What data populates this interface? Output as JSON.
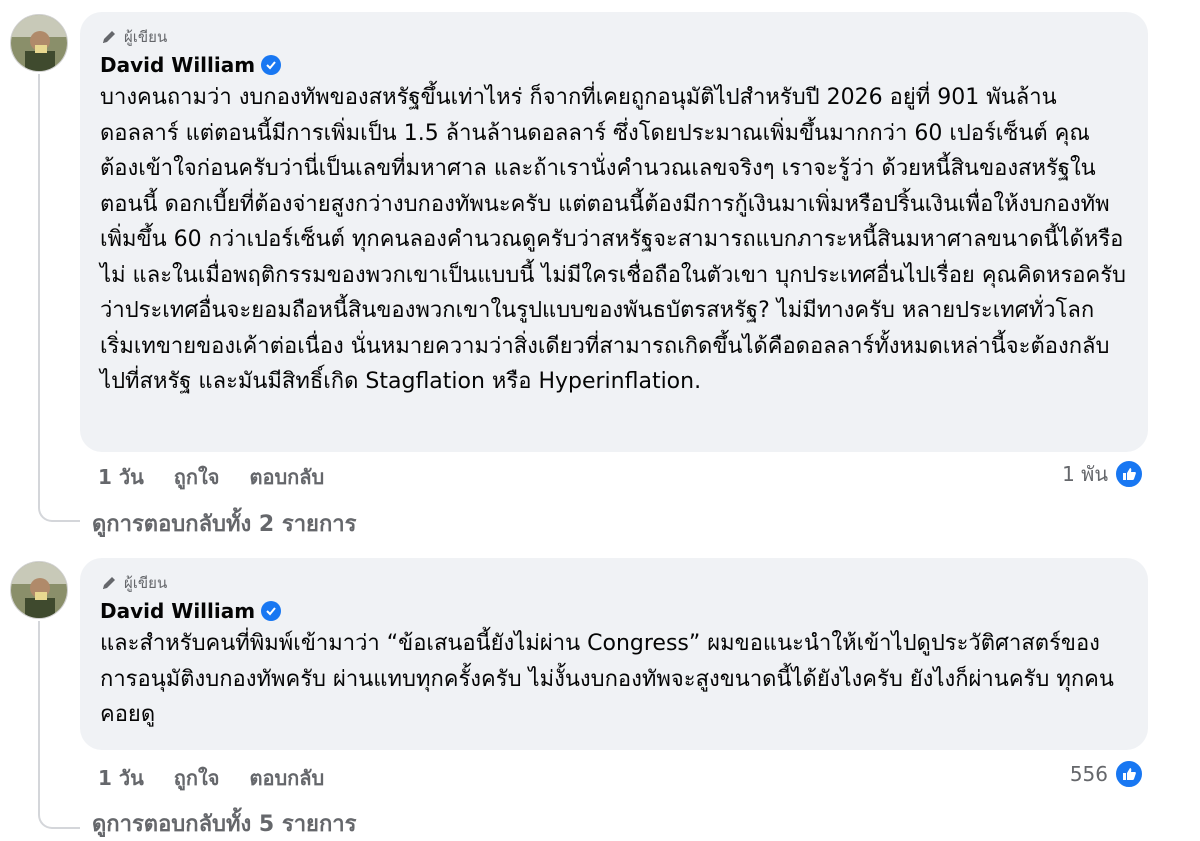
{
  "comments": [
    {
      "badge": "ผู้เขียน",
      "author": "David William",
      "text": "บางคนถามว่า งบกองทัพของสหรัฐขึ้นเท่าไหร่ ก็จากที่เคยถูกอนุมัติไปสำหรับปี 2026 อยู่ที่ 901 พันล้านดอลลาร์ แต่ตอนนี้มีการเพิ่มเป็น 1.5 ล้านล้านดอลลาร์ ซึ่งโดยประมาณเพิ่มขึ้นมากกว่า 60 เปอร์เซ็นต์ คุณต้องเข้าใจก่อนครับว่านี่เป็นเลขที่มหาศาล และถ้าเรานั่งคำนวณเลขจริงๆ เราจะรู้ว่า ด้วยหนี้สินของสหรัฐในตอนนี้ ดอกเบี้ยที่ต้องจ่ายสูงกว่างบกองทัพนะครับ แต่ตอนนี้ต้องมีการกู้เงินมาเพิ่มหรือปริ้นเงินเพื่อให้งบกองทัพเพิ่มขึ้น 60 กว่าเปอร์เซ็นต์ ทุกคนลองคำนวณดูครับว่าสหรัฐจะสามารถแบกภาระหนี้สินมหาศาลขนาดนี้ได้หรือไม่ และในเมื่อพฤติกรรมของพวกเขาเป็นแบบนี้ ไม่มีใครเชื่อถือในตัวเขา บุกประเทศอื่นไปเรื่อย คุณคิดหรอครับว่าประเทศอื่นจะยอมถือหนี้สินของพวกเขาในรูปแบบของพันธบัตรสหรัฐ? ไม่มีทางครับ หลายประเทศทั่วโลกเริ่มเทขายของเค้าต่อเนื่อง นั่นหมายความว่าสิ่งเดียวที่สามารถเกิดขึ้นได้คือดอลลาร์ทั้งหมดเหล่านี้จะต้องกลับไปที่สหรัฐ และมันมีสิทธิ์เกิด Stagflation หรือ Hyperinflation.",
      "time": "1 วัน",
      "like_label": "ถูกใจ",
      "reply_label": "ตอบกลับ",
      "reaction_count": "1 พัน",
      "view_replies": "ดูการตอบกลับทั้ง 2 รายการ"
    },
    {
      "badge": "ผู้เขียน",
      "author": "David William",
      "text": "และสำหรับคนที่พิมพ์เข้ามาว่า “ข้อเสนอนี้ยังไม่ผ่าน Congress” ผมขอแนะนำให้เข้าไปดูประวัติศาสตร์ของการอนุมัติงบกองทัพครับ ผ่านแทบทุกครั้งครับ ไม่งั้นงบกองทัพจะสูงขนาดนี้ได้ยังไงครับ ยังไงก็ผ่านครับ ทุกคนคอยดู",
      "time": "1 วัน",
      "like_label": "ถูกใจ",
      "reply_label": "ตอบกลับ",
      "reaction_count": "556",
      "view_replies": "ดูการตอบกลับทั้ง 5 รายการ"
    }
  ],
  "colors": {
    "bubble": "#f0f2f5",
    "secondary_text": "#65676b",
    "accent": "#1877f2"
  }
}
